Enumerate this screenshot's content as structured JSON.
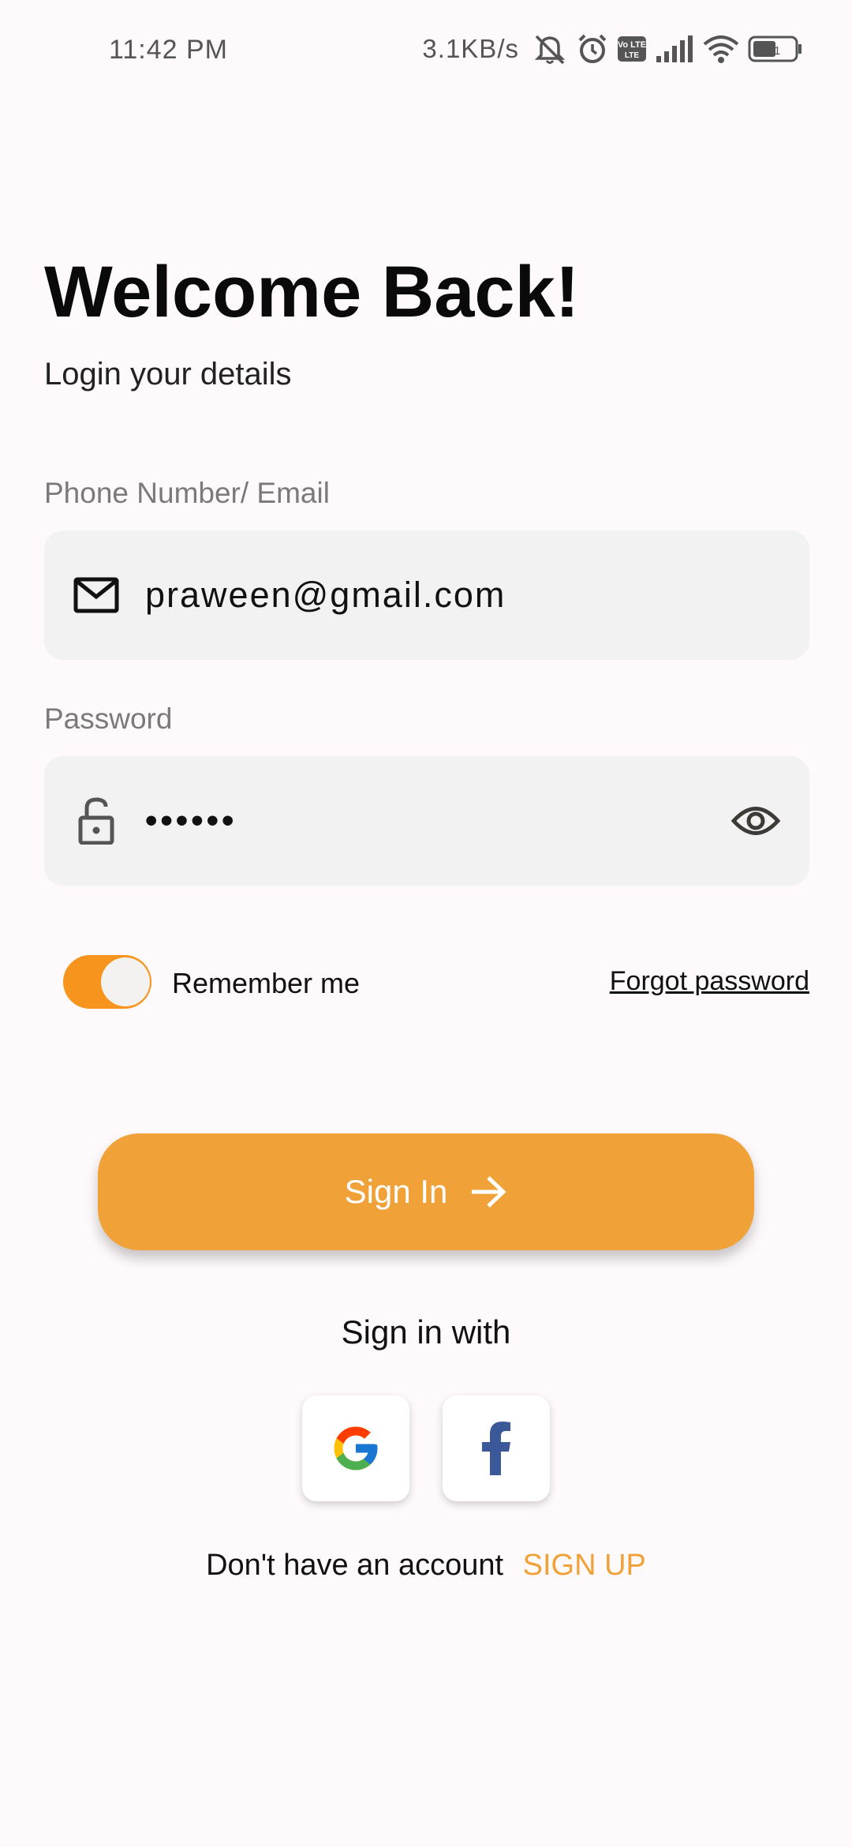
{
  "status_bar": {
    "time": "11:42 PM",
    "speed": "3.1KB/s",
    "icons": [
      "mute-bell-icon",
      "alarm-icon",
      "volte-icon",
      "signal-icon",
      "wifi-icon",
      "battery-icon"
    ],
    "volte_text": "Vo LTE",
    "battery_level": "51"
  },
  "header": {
    "title": "Welcome Back!",
    "subtitle": "Login your details"
  },
  "email_field": {
    "label": "Phone Number/ Email",
    "value": "praween@gmail.com",
    "icon": "mail-icon"
  },
  "password_field": {
    "label": "Password",
    "value": "••••••",
    "icon": "lock-open-icon",
    "toggle_icon": "eye-icon"
  },
  "options": {
    "remember_label": "Remember me",
    "remember_on": true,
    "forgot_label": "Forgot password"
  },
  "sign_in_button": {
    "label": "Sign In",
    "icon": "arrow-right-icon"
  },
  "social": {
    "heading": "Sign in with",
    "providers": [
      "google-icon",
      "facebook-icon"
    ]
  },
  "footer": {
    "prompt": "Don't have an account",
    "signup_label": "SIGN UP"
  },
  "colors": {
    "accent": "#f0a238",
    "toggle": "#f7941d",
    "field_bg": "#f1f2f1",
    "background": "#fefafb"
  }
}
